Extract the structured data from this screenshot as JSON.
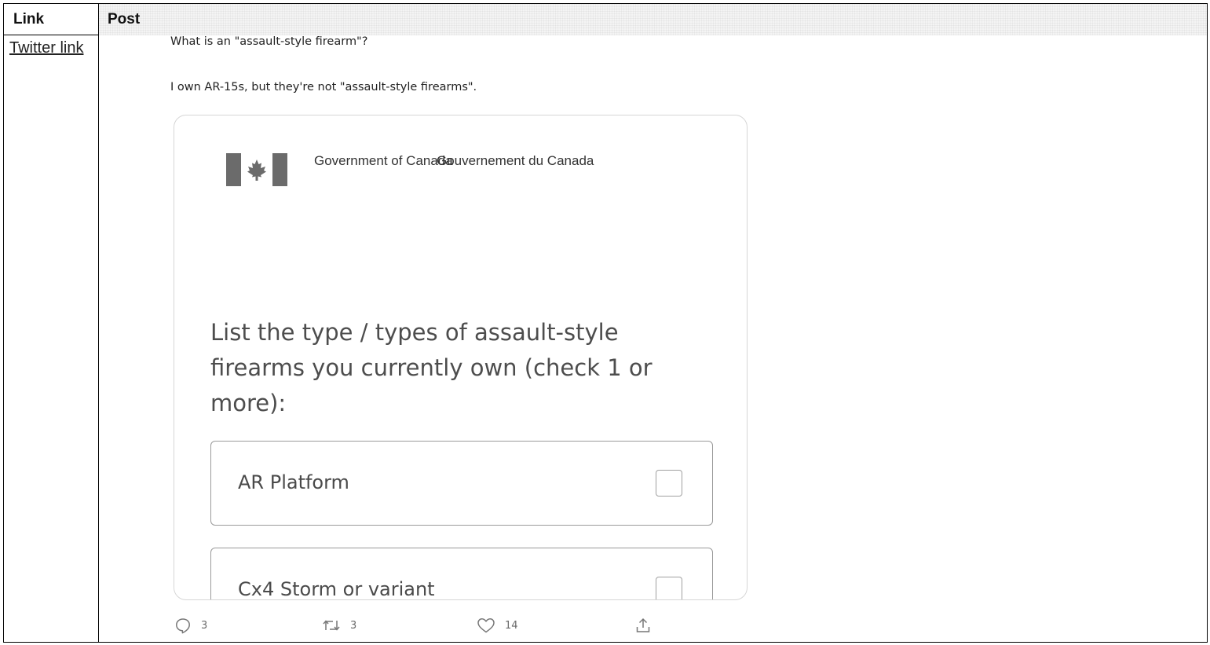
{
  "table": {
    "header_link": "Link",
    "header_post": "Post",
    "link_text": "Twitter link"
  },
  "post": {
    "line1": "What is an \"assault-style firearm\"?",
    "line2": "I own AR-15s, but they're not \"assault-style firearms\"."
  },
  "media": {
    "gov_en": "Government of Canada",
    "gov_fr": "Gouvernement du Canada",
    "question": "List the type / types of assault-style firearms you currently own (check 1 or more):",
    "options": [
      {
        "label": "AR Platform",
        "checked": false
      },
      {
        "label": "Cx4 Storm or variant",
        "checked": false
      }
    ]
  },
  "actions": {
    "replies": "3",
    "retweets": "3",
    "likes": "14",
    "reply_icon": "reply-icon",
    "retweet_icon": "retweet-icon",
    "like_icon": "heart-icon",
    "share_icon": "share-icon"
  }
}
